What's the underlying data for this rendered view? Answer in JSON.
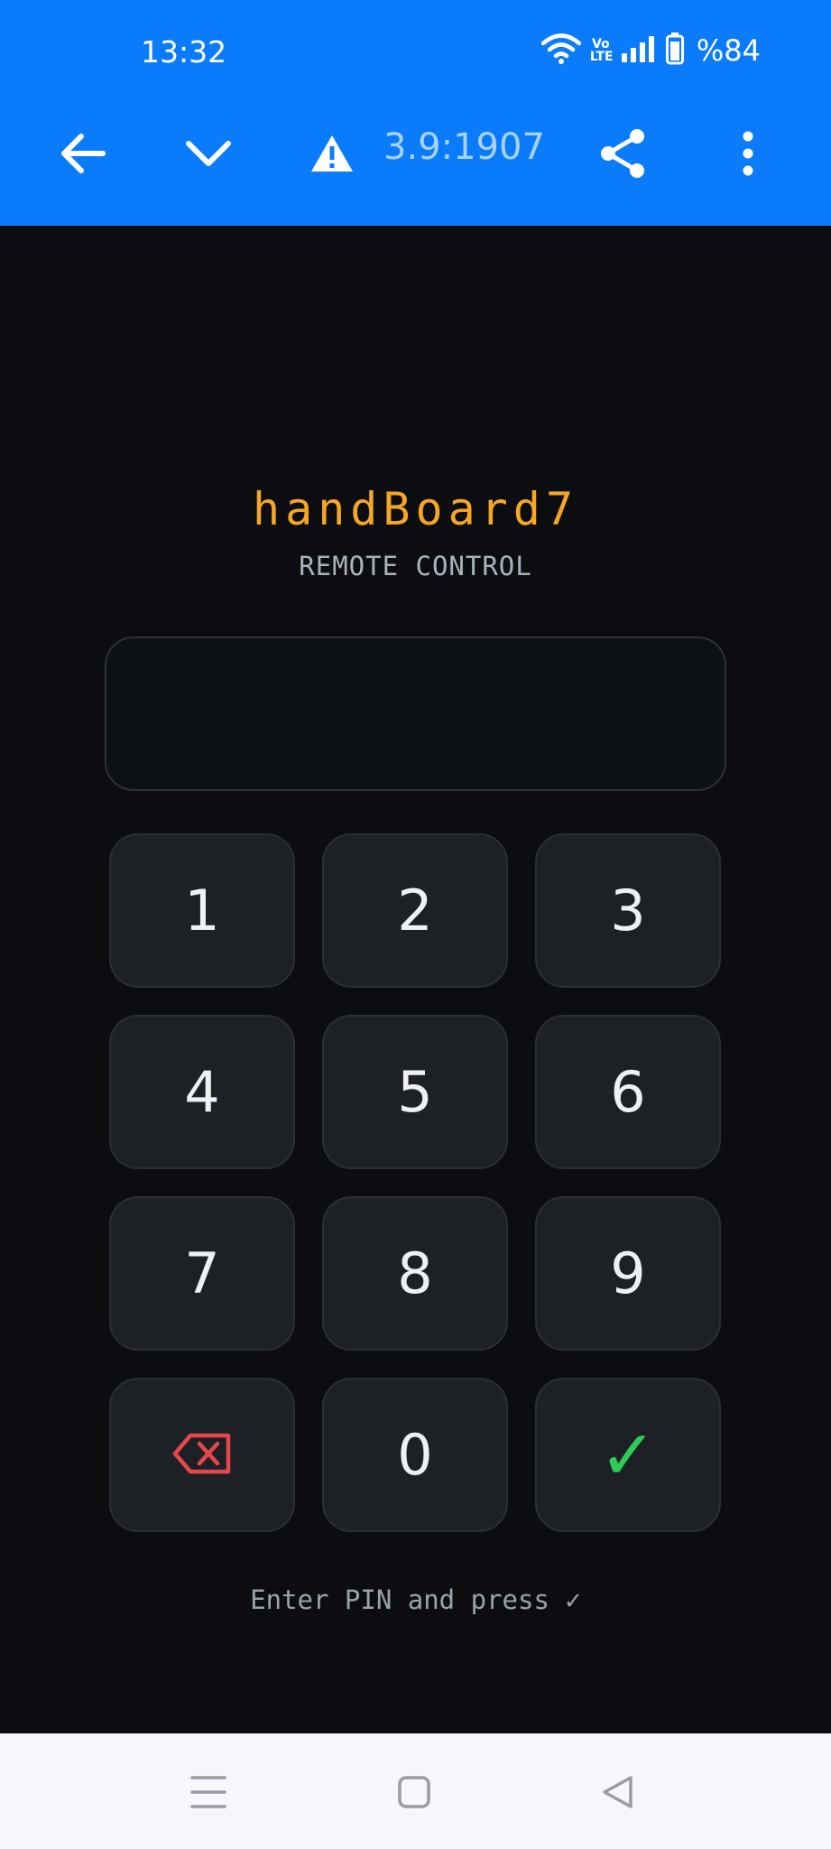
{
  "status_bar": {
    "time": "13:32",
    "network_label": "Vo LTE",
    "battery_text": "%84"
  },
  "browser": {
    "url_fragment": "3.9:1907",
    "icons": [
      "back-arrow-icon",
      "chevron-down-icon",
      "warning-icon",
      "share-icon",
      "more-vert-icon"
    ],
    "bar_color": "#0a7cfb"
  },
  "app": {
    "title": "handBoard7",
    "subtitle": "REMOTE CONTROL",
    "pin_value": "",
    "accent_color": "#f5a623",
    "keys": [
      "1",
      "2",
      "3",
      "4",
      "5",
      "6",
      "7",
      "8",
      "9",
      "0"
    ],
    "confirm_label": "✓",
    "confirm_color": "#2ecc57",
    "backspace_color": "#e5474d",
    "hint": "Enter PIN and press ✓"
  },
  "nav": {
    "icons": [
      "recents-icon",
      "home-icon",
      "back-icon"
    ]
  }
}
